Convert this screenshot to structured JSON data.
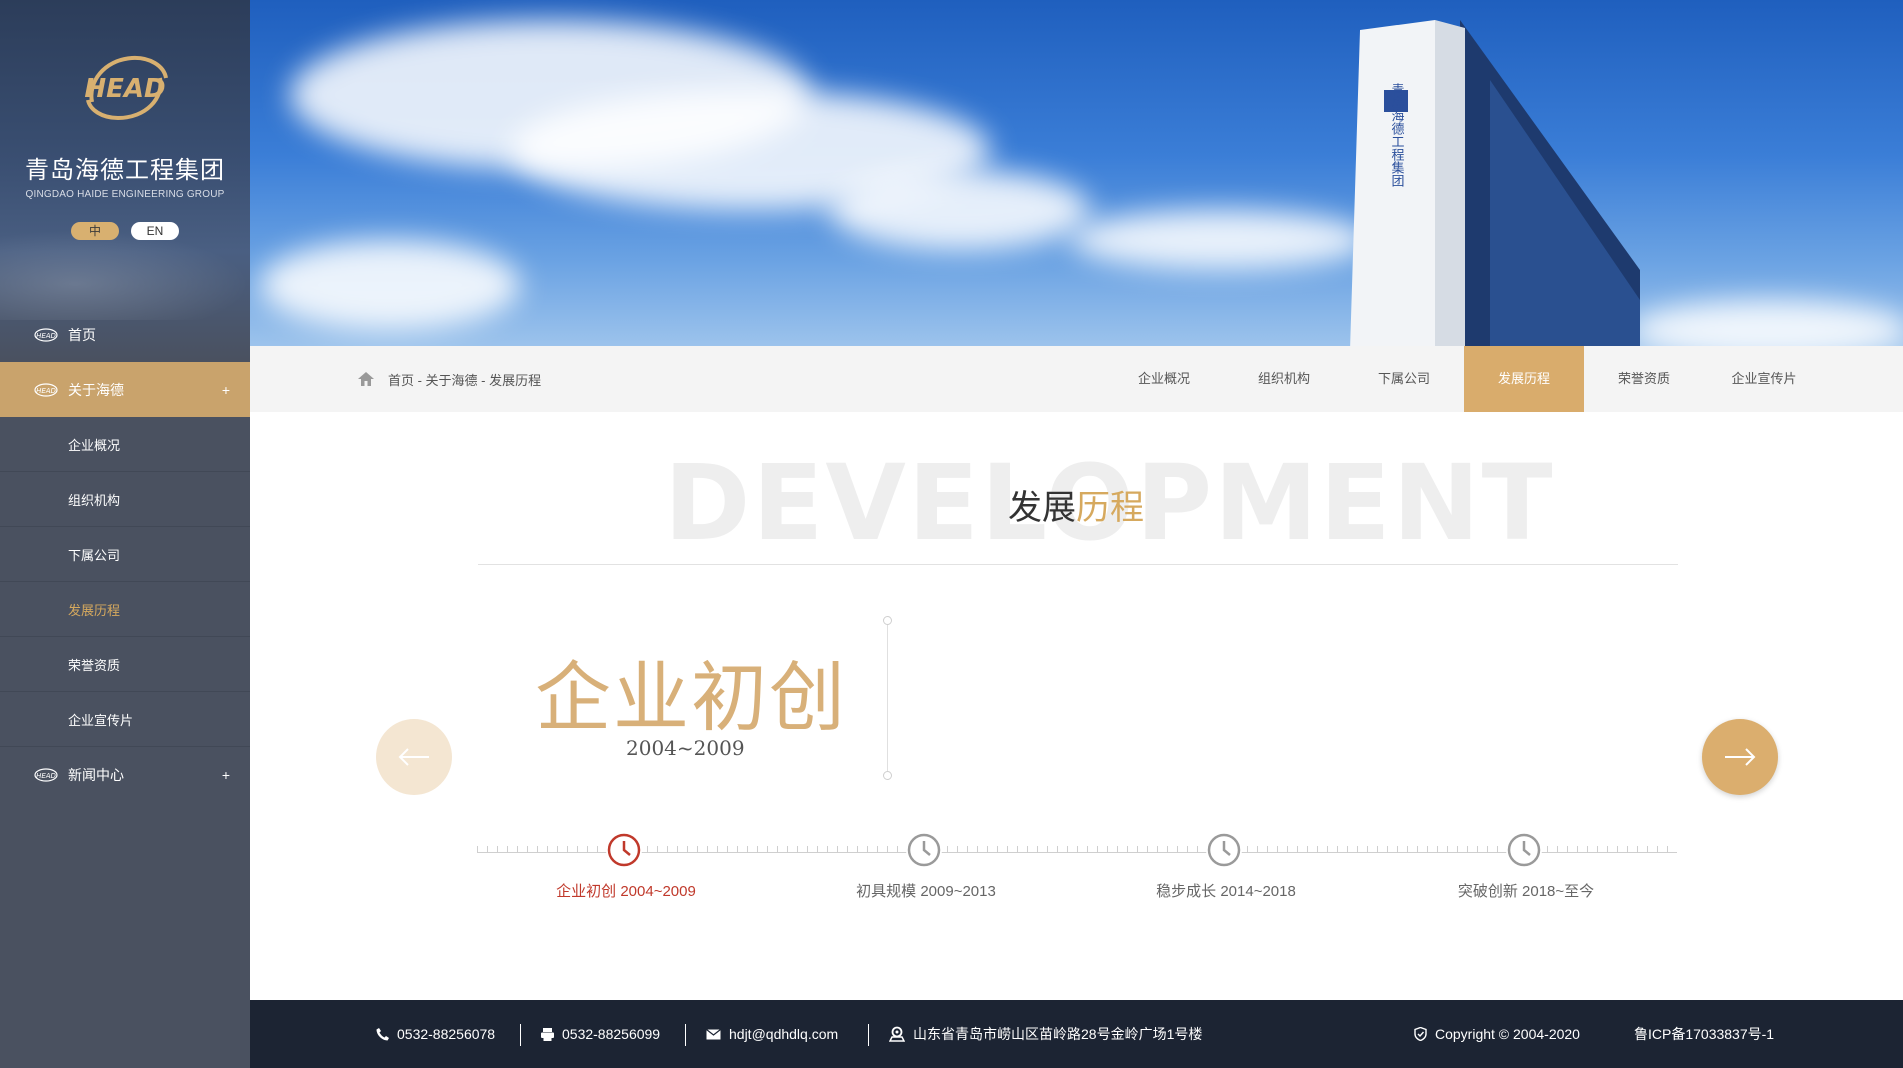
{
  "brand": {
    "name_cn": "青岛海德工程集团",
    "name_en": "QINGDAO HAIDE ENGINEERING GROUP",
    "logo_text": "HEAD"
  },
  "lang": {
    "zh": "中",
    "en": "EN"
  },
  "nav": {
    "home": "首页",
    "about": "关于海德",
    "about_sub": [
      "企业概况",
      "组织机构",
      "下属公司",
      "发展历程",
      "荣誉资质",
      "企业宣传片"
    ],
    "news": "新闻中心",
    "expand_symbol": "+"
  },
  "tower_sign": "青岛海德工程集团",
  "breadcrumb": "首页 - 关于海德 - 发展历程",
  "tabs": [
    "企业概况",
    "组织机构",
    "下属公司",
    "发展历程",
    "荣誉资质",
    "企业宣传片"
  ],
  "section": {
    "bg_word": "DEVELOPMENT",
    "title_a": "发展",
    "title_b": "历程"
  },
  "stage": {
    "title": "企业初创",
    "range": "2004~2009"
  },
  "timeline": [
    {
      "label": "企业初创 2004~2009",
      "active": true
    },
    {
      "label": "初具规模 2009~2013",
      "active": false
    },
    {
      "label": "稳步成长 2014~2018",
      "active": false
    },
    {
      "label": "突破创新 2018~至今",
      "active": false
    }
  ],
  "footer": {
    "phone": "0532-88256078",
    "fax": "0532-88256099",
    "email": "hdjt@qdhdlq.com",
    "address": "山东省青岛市崂山区苗岭路28号金岭广场1号楼",
    "copyright": "Copyright © 2004-2020",
    "icp": "鲁ICP备17033837号-1"
  },
  "colors": {
    "gold": "#d9ac6c",
    "sidebar": "#4a5160",
    "footer": "#1c2433",
    "active_red": "#c0392b"
  }
}
